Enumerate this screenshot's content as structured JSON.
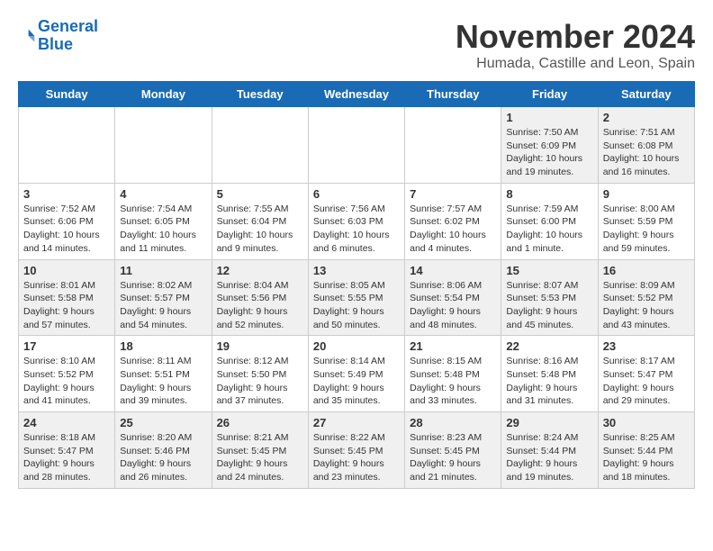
{
  "header": {
    "logo_line1": "General",
    "logo_line2": "Blue",
    "month_year": "November 2024",
    "location": "Humada, Castille and Leon, Spain"
  },
  "weekdays": [
    "Sunday",
    "Monday",
    "Tuesday",
    "Wednesday",
    "Thursday",
    "Friday",
    "Saturday"
  ],
  "weeks": [
    [
      {
        "day": "",
        "info": ""
      },
      {
        "day": "",
        "info": ""
      },
      {
        "day": "",
        "info": ""
      },
      {
        "day": "",
        "info": ""
      },
      {
        "day": "",
        "info": ""
      },
      {
        "day": "1",
        "info": "Sunrise: 7:50 AM\nSunset: 6:09 PM\nDaylight: 10 hours\nand 19 minutes."
      },
      {
        "day": "2",
        "info": "Sunrise: 7:51 AM\nSunset: 6:08 PM\nDaylight: 10 hours\nand 16 minutes."
      }
    ],
    [
      {
        "day": "3",
        "info": "Sunrise: 7:52 AM\nSunset: 6:06 PM\nDaylight: 10 hours\nand 14 minutes."
      },
      {
        "day": "4",
        "info": "Sunrise: 7:54 AM\nSunset: 6:05 PM\nDaylight: 10 hours\nand 11 minutes."
      },
      {
        "day": "5",
        "info": "Sunrise: 7:55 AM\nSunset: 6:04 PM\nDaylight: 10 hours\nand 9 minutes."
      },
      {
        "day": "6",
        "info": "Sunrise: 7:56 AM\nSunset: 6:03 PM\nDaylight: 10 hours\nand 6 minutes."
      },
      {
        "day": "7",
        "info": "Sunrise: 7:57 AM\nSunset: 6:02 PM\nDaylight: 10 hours\nand 4 minutes."
      },
      {
        "day": "8",
        "info": "Sunrise: 7:59 AM\nSunset: 6:00 PM\nDaylight: 10 hours\nand 1 minute."
      },
      {
        "day": "9",
        "info": "Sunrise: 8:00 AM\nSunset: 5:59 PM\nDaylight: 9 hours\nand 59 minutes."
      }
    ],
    [
      {
        "day": "10",
        "info": "Sunrise: 8:01 AM\nSunset: 5:58 PM\nDaylight: 9 hours\nand 57 minutes."
      },
      {
        "day": "11",
        "info": "Sunrise: 8:02 AM\nSunset: 5:57 PM\nDaylight: 9 hours\nand 54 minutes."
      },
      {
        "day": "12",
        "info": "Sunrise: 8:04 AM\nSunset: 5:56 PM\nDaylight: 9 hours\nand 52 minutes."
      },
      {
        "day": "13",
        "info": "Sunrise: 8:05 AM\nSunset: 5:55 PM\nDaylight: 9 hours\nand 50 minutes."
      },
      {
        "day": "14",
        "info": "Sunrise: 8:06 AM\nSunset: 5:54 PM\nDaylight: 9 hours\nand 48 minutes."
      },
      {
        "day": "15",
        "info": "Sunrise: 8:07 AM\nSunset: 5:53 PM\nDaylight: 9 hours\nand 45 minutes."
      },
      {
        "day": "16",
        "info": "Sunrise: 8:09 AM\nSunset: 5:52 PM\nDaylight: 9 hours\nand 43 minutes."
      }
    ],
    [
      {
        "day": "17",
        "info": "Sunrise: 8:10 AM\nSunset: 5:52 PM\nDaylight: 9 hours\nand 41 minutes."
      },
      {
        "day": "18",
        "info": "Sunrise: 8:11 AM\nSunset: 5:51 PM\nDaylight: 9 hours\nand 39 minutes."
      },
      {
        "day": "19",
        "info": "Sunrise: 8:12 AM\nSunset: 5:50 PM\nDaylight: 9 hours\nand 37 minutes."
      },
      {
        "day": "20",
        "info": "Sunrise: 8:14 AM\nSunset: 5:49 PM\nDaylight: 9 hours\nand 35 minutes."
      },
      {
        "day": "21",
        "info": "Sunrise: 8:15 AM\nSunset: 5:48 PM\nDaylight: 9 hours\nand 33 minutes."
      },
      {
        "day": "22",
        "info": "Sunrise: 8:16 AM\nSunset: 5:48 PM\nDaylight: 9 hours\nand 31 minutes."
      },
      {
        "day": "23",
        "info": "Sunrise: 8:17 AM\nSunset: 5:47 PM\nDaylight: 9 hours\nand 29 minutes."
      }
    ],
    [
      {
        "day": "24",
        "info": "Sunrise: 8:18 AM\nSunset: 5:47 PM\nDaylight: 9 hours\nand 28 minutes."
      },
      {
        "day": "25",
        "info": "Sunrise: 8:20 AM\nSunset: 5:46 PM\nDaylight: 9 hours\nand 26 minutes."
      },
      {
        "day": "26",
        "info": "Sunrise: 8:21 AM\nSunset: 5:45 PM\nDaylight: 9 hours\nand 24 minutes."
      },
      {
        "day": "27",
        "info": "Sunrise: 8:22 AM\nSunset: 5:45 PM\nDaylight: 9 hours\nand 23 minutes."
      },
      {
        "day": "28",
        "info": "Sunrise: 8:23 AM\nSunset: 5:45 PM\nDaylight: 9 hours\nand 21 minutes."
      },
      {
        "day": "29",
        "info": "Sunrise: 8:24 AM\nSunset: 5:44 PM\nDaylight: 9 hours\nand 19 minutes."
      },
      {
        "day": "30",
        "info": "Sunrise: 8:25 AM\nSunset: 5:44 PM\nDaylight: 9 hours\nand 18 minutes."
      }
    ]
  ]
}
